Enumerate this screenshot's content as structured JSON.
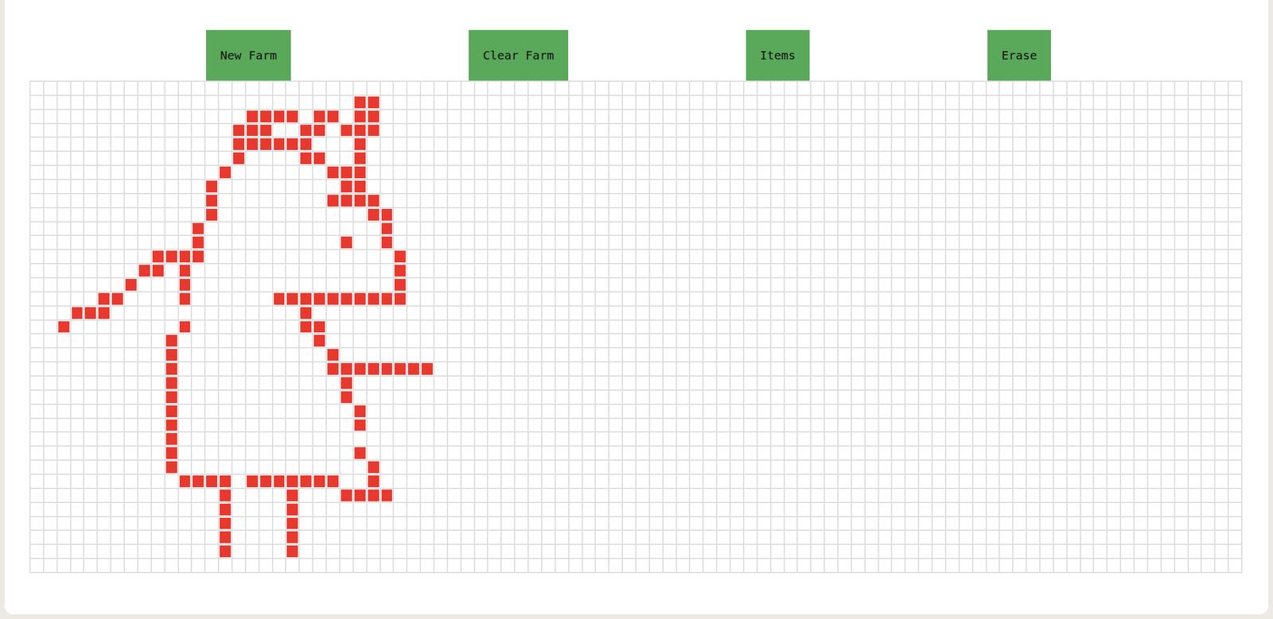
{
  "toolbar": {
    "buttons": [
      {
        "label": "New Farm"
      },
      {
        "label": "Clear Farm"
      },
      {
        "label": "Items"
      },
      {
        "label": "Erase"
      }
    ]
  },
  "grid": {
    "columns": 90,
    "rows": 35,
    "color": "#e8392f",
    "painted": [
      {
        "row": 1,
        "cols": [
          24,
          25
        ]
      },
      {
        "row": 2,
        "cols": [
          16,
          17,
          18,
          19,
          21,
          22,
          24,
          25
        ]
      },
      {
        "row": 3,
        "cols": [
          15,
          16,
          17,
          20,
          21,
          23,
          24,
          25
        ]
      },
      {
        "row": 4,
        "cols": [
          15,
          16,
          17,
          18,
          19,
          20,
          24
        ]
      },
      {
        "row": 5,
        "cols": [
          15,
          20,
          21,
          24
        ]
      },
      {
        "row": 6,
        "cols": [
          14,
          22,
          23,
          24
        ]
      },
      {
        "row": 7,
        "cols": [
          13,
          23,
          24
        ]
      },
      {
        "row": 8,
        "cols": [
          13,
          22,
          23,
          24,
          25
        ]
      },
      {
        "row": 9,
        "cols": [
          13,
          25,
          26
        ]
      },
      {
        "row": 10,
        "cols": [
          12,
          26
        ]
      },
      {
        "row": 11,
        "cols": [
          12,
          23,
          26
        ]
      },
      {
        "row": 12,
        "cols": [
          9,
          10,
          11,
          12,
          27
        ]
      },
      {
        "row": 13,
        "cols": [
          8,
          9,
          11,
          27
        ]
      },
      {
        "row": 14,
        "cols": [
          7,
          11,
          27
        ]
      },
      {
        "row": 15,
        "cols": [
          5,
          6,
          11,
          18,
          19,
          20,
          21,
          22,
          23,
          24,
          25,
          26,
          27
        ]
      },
      {
        "row": 16,
        "cols": [
          3,
          4,
          5,
          20
        ]
      },
      {
        "row": 17,
        "cols": [
          2,
          11,
          20,
          21
        ]
      },
      {
        "row": 18,
        "cols": [
          10,
          21
        ]
      },
      {
        "row": 19,
        "cols": [
          10,
          22
        ]
      },
      {
        "row": 20,
        "cols": [
          10,
          22,
          23,
          24,
          25,
          26,
          27,
          28,
          29
        ]
      },
      {
        "row": 21,
        "cols": [
          10,
          23
        ]
      },
      {
        "row": 22,
        "cols": [
          10,
          23
        ]
      },
      {
        "row": 23,
        "cols": [
          10,
          24
        ]
      },
      {
        "row": 24,
        "cols": [
          10,
          24
        ]
      },
      {
        "row": 25,
        "cols": [
          10
        ]
      },
      {
        "row": 26,
        "cols": [
          10,
          24
        ]
      },
      {
        "row": 27,
        "cols": [
          10,
          25
        ]
      },
      {
        "row": 28,
        "cols": [
          11,
          12,
          13,
          14,
          16,
          17,
          18,
          19,
          20,
          21,
          22,
          25
        ]
      },
      {
        "row": 29,
        "cols": [
          14,
          19,
          23,
          24,
          25,
          26
        ]
      },
      {
        "row": 30,
        "cols": [
          14,
          19
        ]
      },
      {
        "row": 31,
        "cols": [
          14,
          19
        ]
      },
      {
        "row": 32,
        "cols": [
          14,
          19
        ]
      },
      {
        "row": 33,
        "cols": [
          14,
          19
        ]
      }
    ]
  }
}
